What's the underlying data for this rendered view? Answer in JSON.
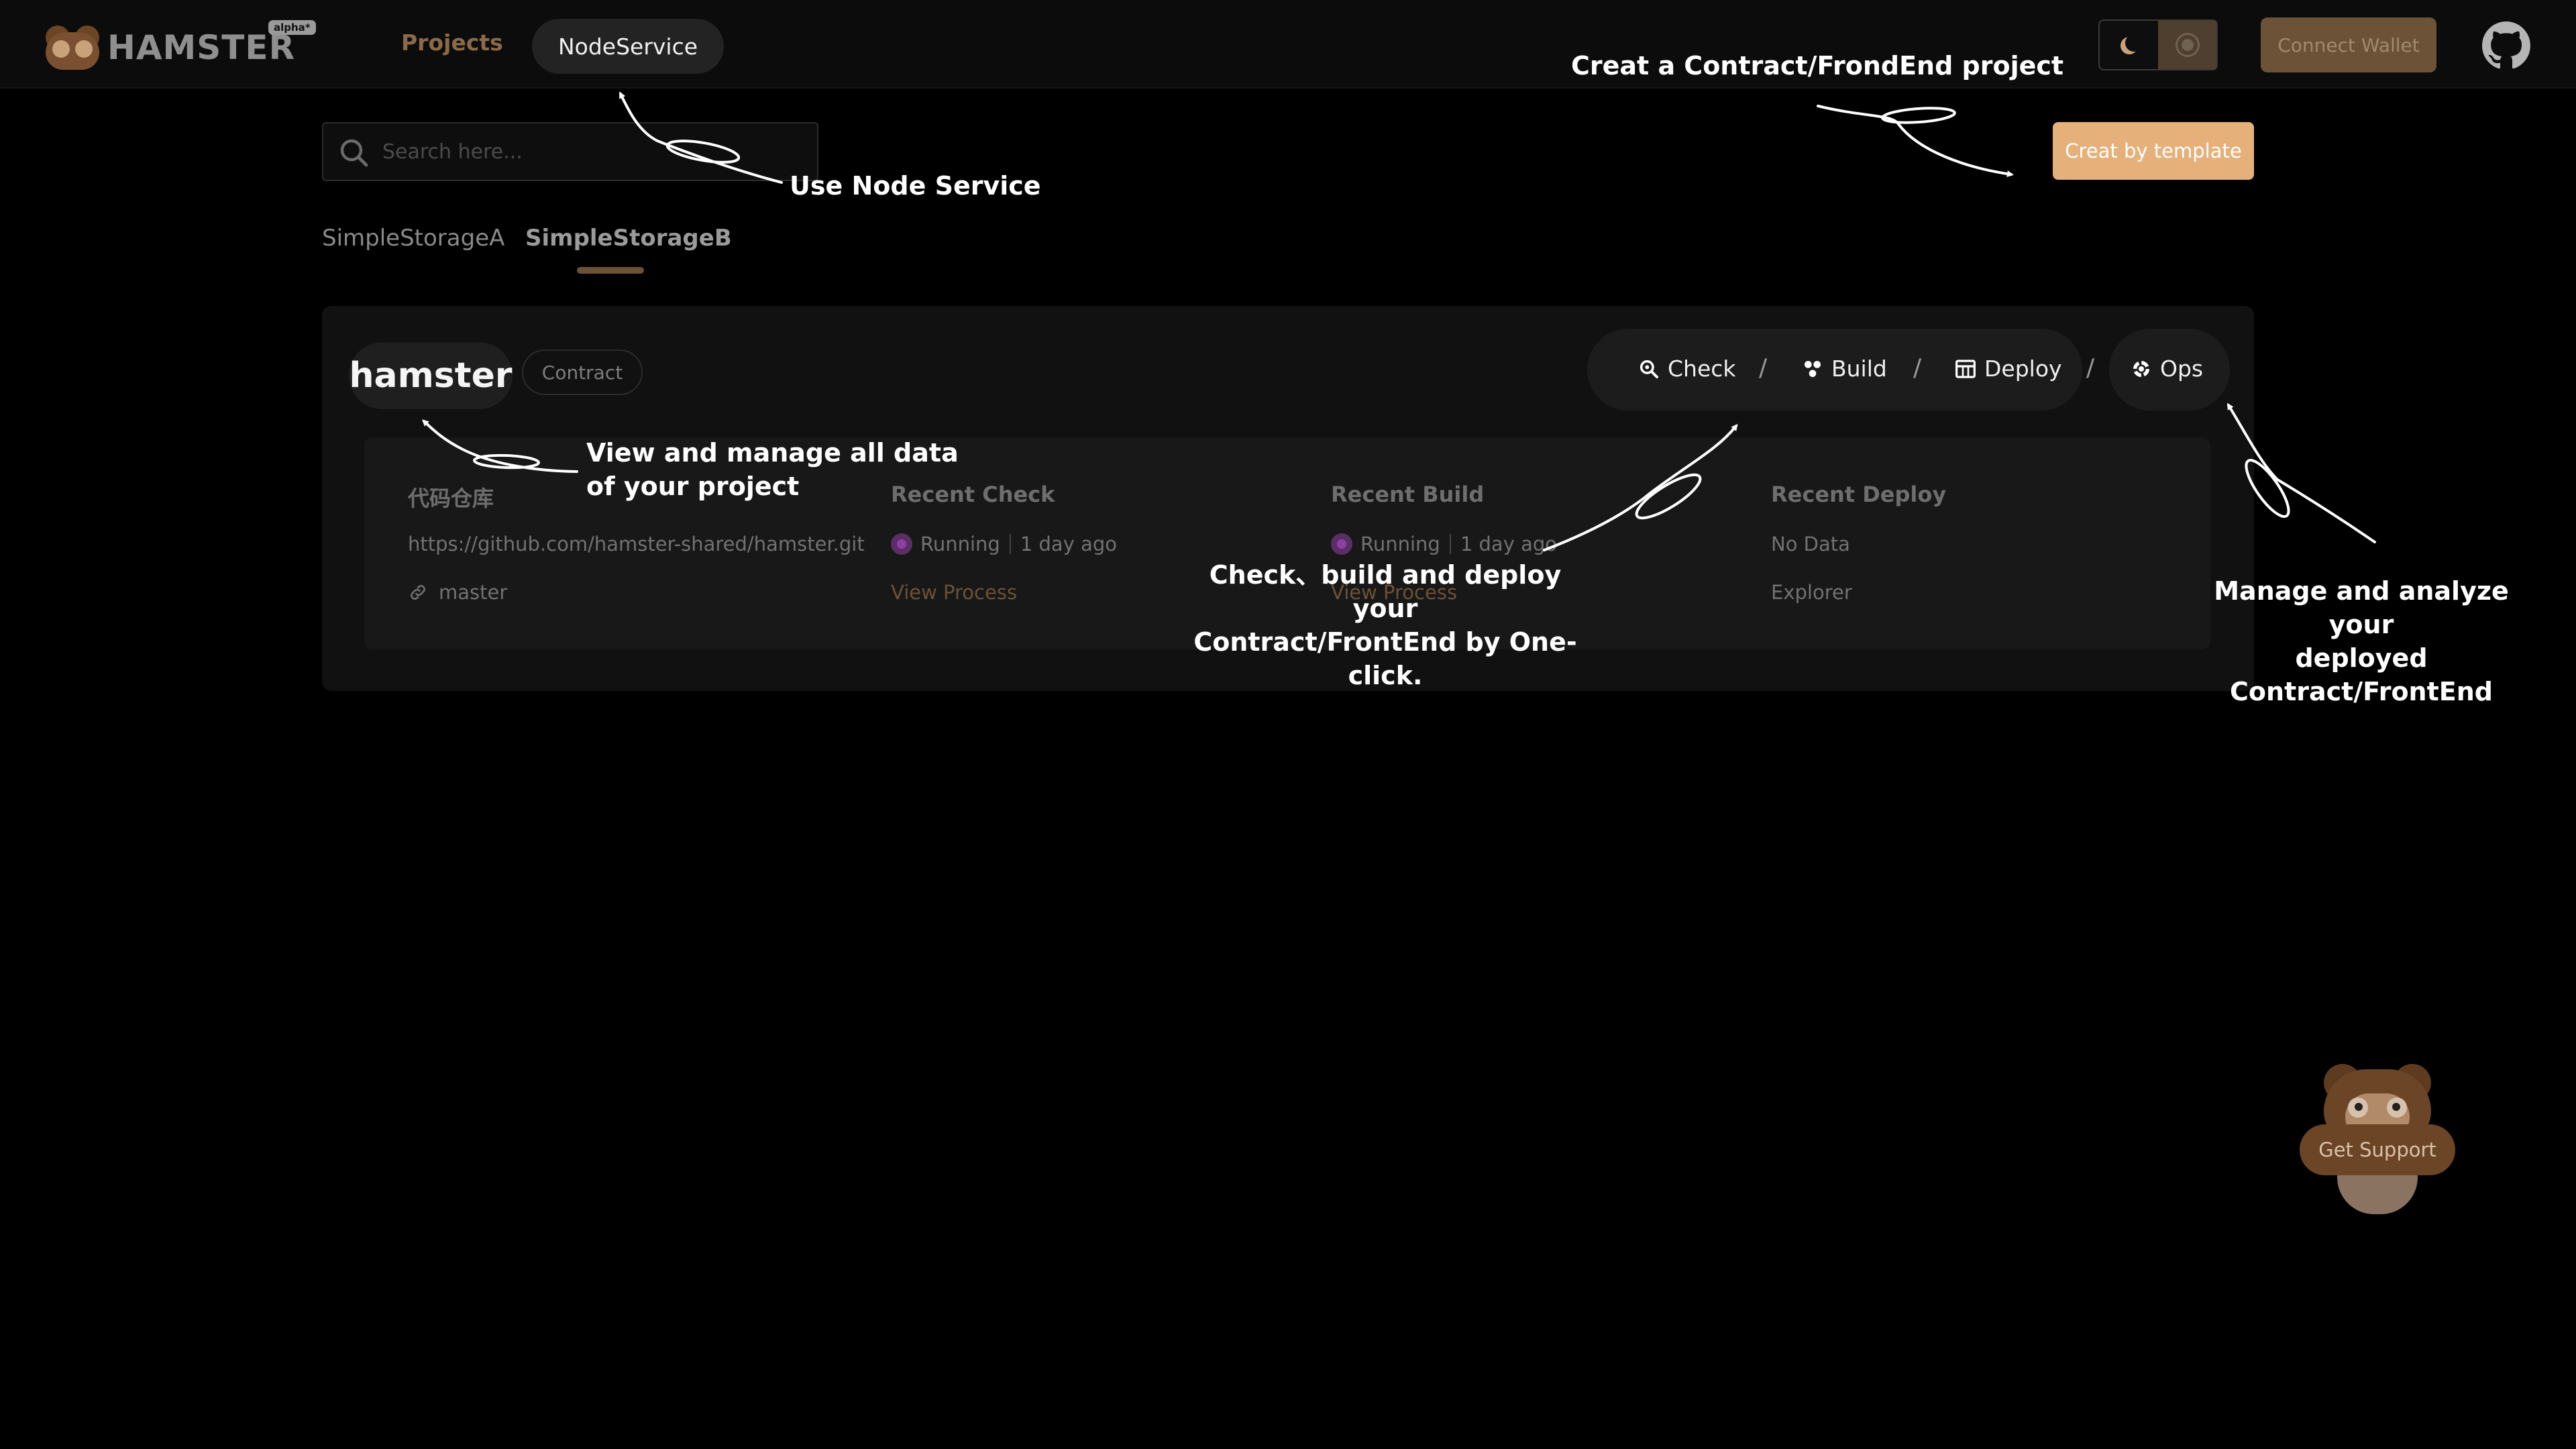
{
  "app": {
    "logo_text": "HAMSTER",
    "badge": "alpha*"
  },
  "nav": {
    "projects": "Projects",
    "node_service": "NodeService"
  },
  "header": {
    "connect_wallet": "Connect Wallet",
    "theme": {
      "active": "dark"
    }
  },
  "search": {
    "placeholder": "Search here..."
  },
  "create_button": "Creat by template",
  "tabs": [
    {
      "label": "SimpleStorageA",
      "active": false
    },
    {
      "label": "SimpleStorageB",
      "active": true
    }
  ],
  "project": {
    "name": "hamster",
    "type": "Contract",
    "actions": {
      "check": "Check",
      "build": "Build",
      "deploy": "Deploy",
      "ops": "Ops",
      "separator": "/"
    },
    "repo": {
      "header": "代码仓库",
      "url": "https://github.com/hamster-shared/hamster.git",
      "branch": "master"
    },
    "recent_check": {
      "header": "Recent Check",
      "status": "Running",
      "time": "1 day ago",
      "link": "View Process"
    },
    "recent_build": {
      "header": "Recent Build",
      "status": "Running",
      "time": "1 day ago",
      "link": "View Process"
    },
    "recent_deploy": {
      "header": "Recent Deploy",
      "status": "No Data",
      "link": "Explorer"
    }
  },
  "annotations": {
    "create": "Creat a Contract/FrondEnd project",
    "node": "Use Node Service",
    "view_line1": "View and manage all data",
    "view_line2": "of your project",
    "pipeline_line1": "Check、build and deploy your",
    "pipeline_line2": "Contract/FrontEnd by One-click.",
    "ops_line1": "Manage and analyze your",
    "ops_line2": "deployed Contract/FrontEnd"
  },
  "support": {
    "label": "Get Support"
  },
  "colors": {
    "accent": "#e6b07a",
    "accent_dark": "#6b5237",
    "running": "#8d3fa3",
    "background": "#000000"
  },
  "icons": [
    "search-icon",
    "moon-icon",
    "sun-icon",
    "github-icon",
    "check-search-icon",
    "build-icon",
    "deploy-icon",
    "ops-icon",
    "link-icon",
    "running-icon"
  ]
}
